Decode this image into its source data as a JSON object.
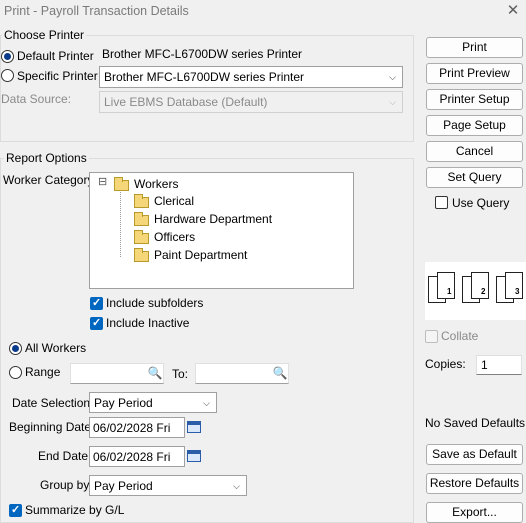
{
  "window": {
    "title": "Print - Payroll Transaction Details",
    "close_glyph": "✕"
  },
  "choose_printer": {
    "legend": "Choose Printer",
    "default_label": "Default Printer",
    "default_value": "Brother MFC-L6700DW series Printer",
    "specific_label": "Specific Printer",
    "specific_value": "Brother MFC-L6700DW series Printer",
    "data_source_label": "Data Source:",
    "data_source_value": "Live EBMS Database (Default)",
    "selected": "default"
  },
  "report_options": {
    "legend": "Report Options",
    "worker_category_label": "Worker Category:",
    "tree": {
      "root": "Workers",
      "toggle": "⊟",
      "children": [
        "Clerical",
        "Hardware Department",
        "Officers",
        "Paint Department"
      ]
    },
    "include_subfolders": {
      "label": "Include subfolders",
      "checked": true
    },
    "include_inactive": {
      "label": "Include Inactive",
      "checked": true
    },
    "all_workers_label": "All Workers",
    "range_label": "Range",
    "to_label": "To:",
    "range_from": "",
    "range_to": "",
    "worker_selection": "all",
    "date_selection_label": "Date Selection:",
    "date_selection_value": "Pay Period",
    "beginning_date_label": "Beginning Date:",
    "beginning_date_value": "06/02/2028 Fri",
    "end_date_label": "End Date:",
    "end_date_value": "06/02/2028 Fri",
    "group_by_label": "Group by:",
    "group_by_value": "Pay Period",
    "summarize": {
      "label": "Summarize by G/L",
      "checked": true
    }
  },
  "buttons": {
    "print": "Print",
    "print_preview": "Print Preview",
    "printer_setup": "Printer Setup",
    "page_setup": "Page Setup",
    "cancel": "Cancel",
    "set_query": "Set Query",
    "save_as_default": "Save as Default",
    "restore_defaults": "Restore Defaults",
    "export": "Export..."
  },
  "use_query": {
    "label": "Use Query",
    "checked": false
  },
  "collate": {
    "label": "Collate",
    "checked": false,
    "enabled": false,
    "page_numbers": [
      "1",
      "2",
      "3"
    ]
  },
  "copies": {
    "label": "Copies:",
    "value": "1"
  },
  "saved_defaults_status": "No Saved Defaults",
  "icons": {
    "close": "close-icon",
    "folder": "folder-icon",
    "search": "search-icon",
    "calendar": "calendar-icon",
    "dropdown": "chevron-down-icon"
  }
}
